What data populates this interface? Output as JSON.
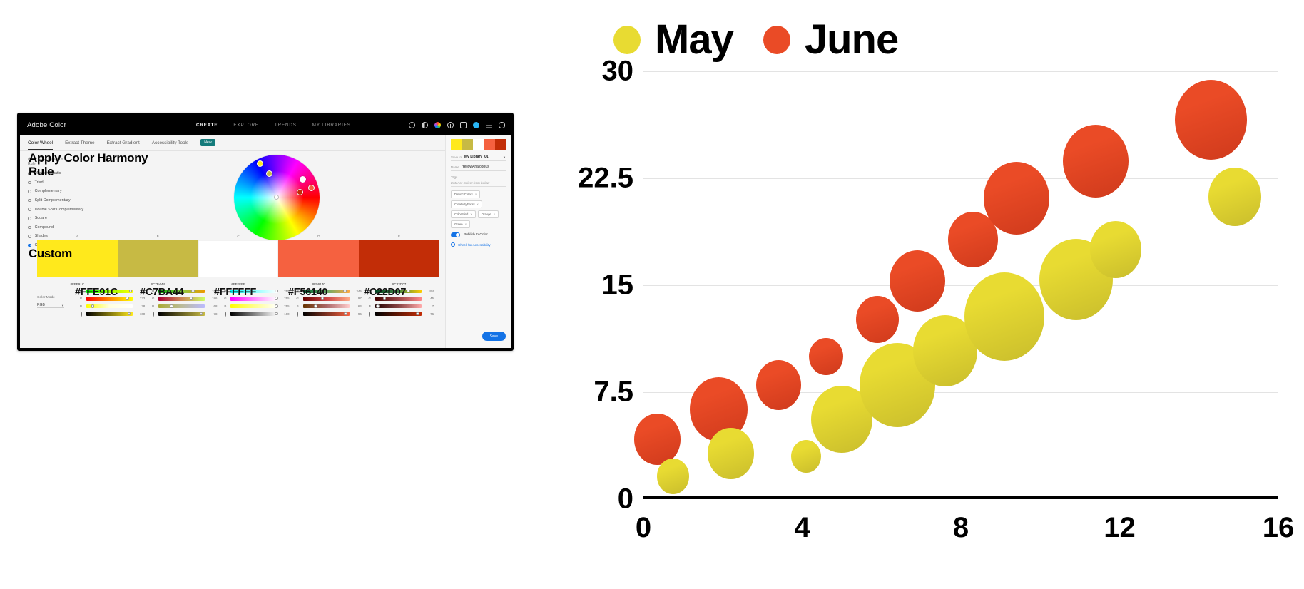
{
  "adobe_color": {
    "brand": "Adobe Color",
    "nav": [
      {
        "label": "CREATE",
        "active": true
      },
      {
        "label": "EXPLORE",
        "active": false
      },
      {
        "label": "TRENDS",
        "active": false
      },
      {
        "label": "MY LIBRARIES",
        "active": false
      }
    ],
    "topbar_icons": [
      "search-icon",
      "contrast-icon",
      "creative-cloud-icon",
      "info-icon",
      "chat-icon",
      "avatar-icon",
      "app-grid-icon",
      "view-icon"
    ],
    "tabs": [
      {
        "label": "Color Wheel",
        "active": true
      },
      {
        "label": "Extract Theme",
        "active": false
      },
      {
        "label": "Extract Gradient",
        "active": false
      },
      {
        "label": "Accessibility Tools",
        "active": false
      }
    ],
    "new_badge": "New",
    "harmony": {
      "title_line1": "Apply Color Harmony",
      "title_line2": "Rule",
      "small_line1": "Apply Color Harmony",
      "small_line2": "Rule",
      "rules": [
        {
          "label": "Monochromatic",
          "selected": false
        },
        {
          "label": "Triad",
          "selected": false
        },
        {
          "label": "Complementary",
          "selected": false
        },
        {
          "label": "Split Complementary",
          "selected": false
        },
        {
          "label": "Double Split Complementary",
          "selected": false
        },
        {
          "label": "Square",
          "selected": false
        },
        {
          "label": "Compound",
          "selected": false
        },
        {
          "label": "Shades",
          "selected": false
        },
        {
          "label": "Custom",
          "selected": true
        }
      ],
      "custom_overlay": "Custom"
    },
    "swatches": [
      {
        "letter": "A",
        "hex": "#FFE91C"
      },
      {
        "letter": "B",
        "hex": "#C7BA44"
      },
      {
        "letter": "C",
        "hex": "#FFFFFF"
      },
      {
        "letter": "D",
        "hex": "#F56140"
      },
      {
        "letter": "E",
        "hex": "#C22D07"
      }
    ],
    "color_mode_label": "Color Mode",
    "color_mode_value": "RGB",
    "slider_channels": [
      "R",
      "G",
      "B"
    ],
    "slider_values": [
      [
        "255",
        "233",
        "28"
      ],
      [
        "199",
        "186",
        "68"
      ],
      [
        "255",
        "255",
        "255"
      ],
      [
        "245",
        "97",
        "64"
      ],
      [
        "194",
        "45",
        "7"
      ]
    ],
    "brightness_values": [
      "100",
      "78",
      "100",
      "96",
      "76"
    ],
    "sidebar": {
      "save_to_key": "Save to",
      "save_to_value": "My Library_01",
      "name_key": "Name",
      "name_value": "YellowAnalogous",
      "tags_key": "Tags",
      "tags_placeholder": "Enter or Select from below",
      "tags": [
        "DistinctColors",
        "CreativityForAll",
        "ColorBlind",
        "Orange",
        "Green"
      ],
      "publish_label": "Publish to Color",
      "accessibility_label": "Check for Accessibility",
      "save_label": "Save"
    }
  },
  "chart_data": {
    "type": "scatter",
    "title": "",
    "xlabel": "",
    "ylabel": "",
    "xlim": [
      0,
      16
    ],
    "ylim": [
      0,
      30
    ],
    "xticks": [
      "0",
      "4",
      "8",
      "12",
      "16"
    ],
    "yticks": [
      "0",
      "7.5",
      "15",
      "22.5",
      "30"
    ],
    "grid": true,
    "legend_position": "top",
    "colors": {
      "may": "#E8DB32",
      "june": "#EA4B26"
    },
    "series": [
      {
        "name": "May",
        "color": "#E8DB32",
        "points": [
          {
            "x": 0.75,
            "y": 1.6,
            "size": 3.2
          },
          {
            "x": 2.2,
            "y": 3.2,
            "size": 4.6
          },
          {
            "x": 4.1,
            "y": 3.0,
            "size": 3.0
          },
          {
            "x": 5.0,
            "y": 5.6,
            "size": 6.1
          },
          {
            "x": 6.4,
            "y": 8.0,
            "size": 7.6
          },
          {
            "x": 7.6,
            "y": 10.4,
            "size": 6.4
          },
          {
            "x": 9.1,
            "y": 12.8,
            "size": 8.0
          },
          {
            "x": 10.9,
            "y": 15.4,
            "size": 7.4
          },
          {
            "x": 11.9,
            "y": 17.5,
            "size": 5.2
          },
          {
            "x": 14.9,
            "y": 21.2,
            "size": 5.3
          }
        ]
      },
      {
        "name": "June",
        "color": "#EA4B26",
        "points": [
          {
            "x": 0.35,
            "y": 4.2,
            "size": 4.6
          },
          {
            "x": 1.9,
            "y": 6.3,
            "size": 5.8
          },
          {
            "x": 3.4,
            "y": 8.0,
            "size": 4.5
          },
          {
            "x": 4.6,
            "y": 10.0,
            "size": 3.4
          },
          {
            "x": 5.9,
            "y": 12.6,
            "size": 4.3
          },
          {
            "x": 6.9,
            "y": 15.3,
            "size": 5.6
          },
          {
            "x": 8.3,
            "y": 18.2,
            "size": 5.0
          },
          {
            "x": 9.4,
            "y": 21.1,
            "size": 6.6
          },
          {
            "x": 11.4,
            "y": 23.7,
            "size": 6.6
          },
          {
            "x": 14.3,
            "y": 26.6,
            "size": 7.2
          }
        ]
      }
    ]
  }
}
